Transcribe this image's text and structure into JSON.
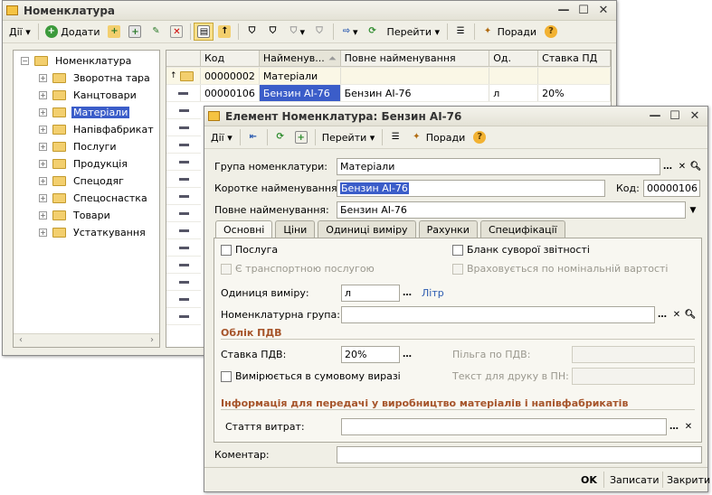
{
  "main": {
    "title": "Номенклатура",
    "toolbar": {
      "actions": "Дії",
      "add": "Додати",
      "goto": "Перейти",
      "hints": "Поради"
    },
    "tree": [
      "Номенклатура",
      "Зворотна тара",
      "Канцтовари",
      "Матеріали",
      "Напівфабрикат",
      "Послуги",
      "Продукція",
      "Спецодяг",
      "Спецоснастка",
      "Товари",
      "Устаткування"
    ],
    "columns": [
      "Код",
      "Найменув...",
      "Повне найменування",
      "Од.",
      "Ставка ПД"
    ],
    "rows": [
      {
        "code": "00000002",
        "name": "Матеріали",
        "full": "",
        "unit": "",
        "rate": ""
      },
      {
        "code": "00000106",
        "name": "Бензин АІ-76",
        "full": "Бензин АІ-76",
        "unit": "л",
        "rate": "20%"
      }
    ]
  },
  "dialog": {
    "title": "Елемент Номенклатура: Бензин АІ-76",
    "toolbar": {
      "actions": "Дії",
      "goto": "Перейти",
      "hints": "Поради"
    },
    "group_label": "Група номенклатури:",
    "group_value": "Матеріали",
    "short_label": "Коротке найменування:",
    "short_value": "Бензин АІ-76",
    "code_label": "Код:",
    "code_value": "00000106",
    "full_label": "Повне найменування:",
    "full_value": "Бензин АІ-76",
    "tabs": [
      "Основні",
      "Ціни",
      "Одиниці виміру",
      "Рахунки",
      "Специфікації"
    ],
    "service": "Послуга",
    "transport": "Є транспортною послугою",
    "strict": "Бланк суворої звітності",
    "nominal": "Враховується по номінальній вартості",
    "unit_label": "Одиниця виміру:",
    "unit_value": "л",
    "unit_name": "Літр",
    "nomgroup_label": "Номенклатурна група:",
    "vat_section": "Облік ПДВ",
    "vat_label": "Ставка ПДВ:",
    "vat_value": "20%",
    "vat_benefit": "Пільга по ПДВ:",
    "vat_sum": "Вимірюється в сумовому виразі",
    "vat_text": "Текст для друку в ПН:",
    "prod_section": "Інформація для передачі у виробництво матеріалів і напівфабрикатів",
    "cost_label": "Стаття витрат:",
    "comment_label": "Коментар:",
    "ok": "OK",
    "save": "Записати",
    "close": "Закрити"
  }
}
